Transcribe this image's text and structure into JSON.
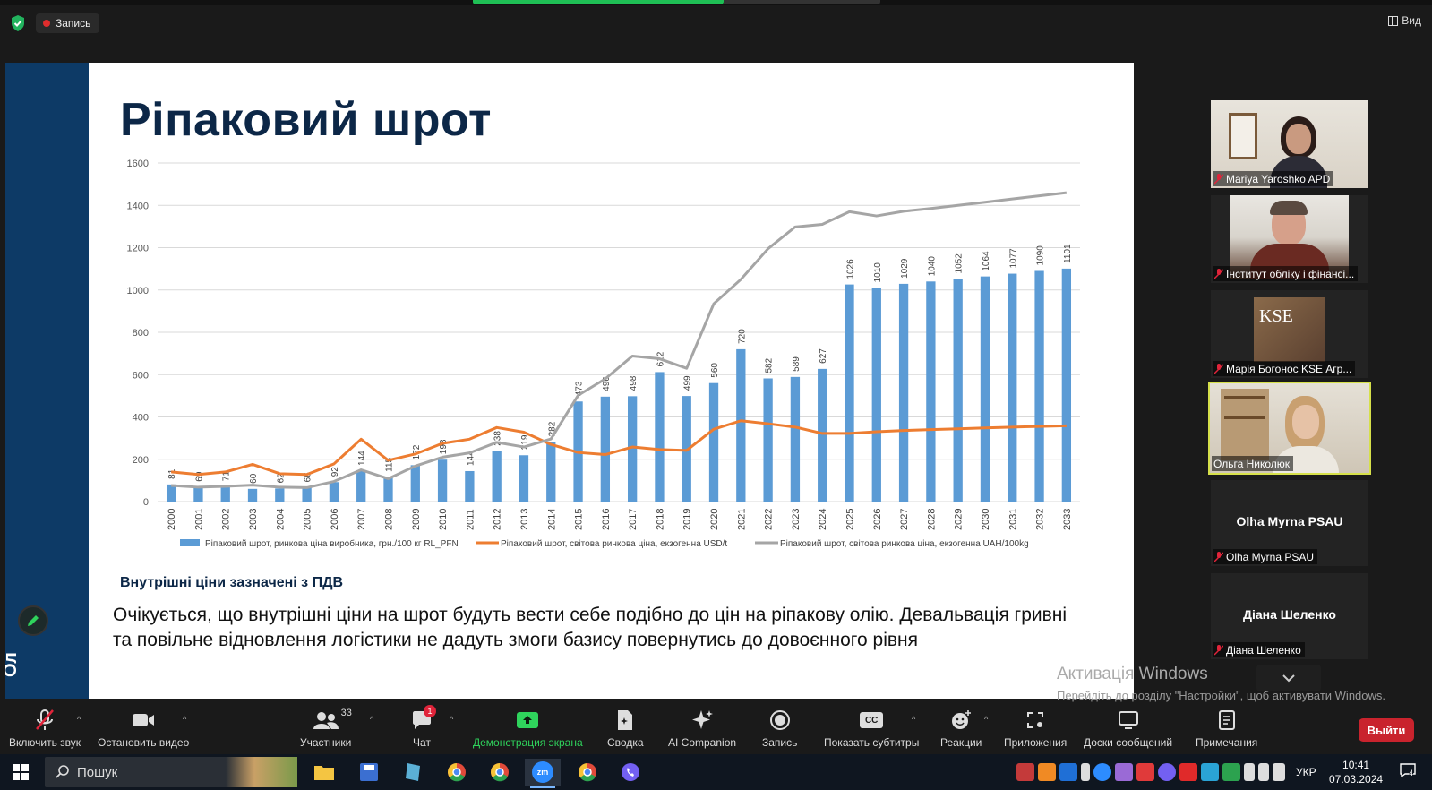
{
  "top": {
    "recording_label": "Запись",
    "view_label": "Вид"
  },
  "slide": {
    "title": "Ріпаковий шрот",
    "sidebar_text": "Ол",
    "subnote": "Внутрішні ціни зазначені з ПДВ",
    "body": "Очікується, що внутрішні ціни на шрот будуть вести себе подібно до цін на ріпакову олію. Девальвація гривні та повільне відновлення логістики не дадуть змоги базису повернутись до довоєнного рівня"
  },
  "chart_data": {
    "type": "bar",
    "categories": [
      "2000",
      "2001",
      "2002",
      "2003",
      "2004",
      "2005",
      "2006",
      "2007",
      "2008",
      "2009",
      "2010",
      "2011",
      "2012",
      "2013",
      "2014",
      "2015",
      "2016",
      "2017",
      "2018",
      "2019",
      "2020",
      "2021",
      "2022",
      "2023",
      "2024",
      "2025",
      "2026",
      "2027",
      "2028",
      "2029",
      "2030",
      "2031",
      "2032",
      "2033"
    ],
    "ylim": [
      0,
      1600
    ],
    "yticks": [
      0,
      200,
      400,
      600,
      800,
      1000,
      1200,
      1400,
      1600
    ],
    "grid": true,
    "legend_position": "bottom",
    "series": [
      {
        "name": "Ріпаковий шрот,  ринкова ціна виробника, грн./100 кг RL_PFN",
        "kind": "bar",
        "color": "#5b9bd5",
        "values": [
          81,
          69,
          71,
          60,
          62,
          66,
          92,
          144,
          115,
          172,
          198,
          144,
          238,
          219,
          282,
          473,
          496,
          498,
          612,
          499,
          560,
          720,
          582,
          589,
          627,
          1026,
          1010,
          1029,
          1040,
          1052,
          1064,
          1077,
          1090,
          1101
        ]
      },
      {
        "name": "Ріпаковий шрот, світова ринкова ціна, екзогенна USD/t",
        "kind": "line",
        "color": "#ed7d31",
        "values": [
          140,
          128,
          140,
          176,
          132,
          128,
          178,
          295,
          195,
          225,
          275,
          295,
          350,
          328,
          270,
          232,
          222,
          258,
          246,
          242,
          342,
          382,
          368,
          352,
          322,
          322,
          330,
          336,
          340,
          344,
          348,
          352,
          355,
          358
        ]
      },
      {
        "name": "Ріпаковий шрот, світова ринкова ціна, екзогенна UAH/100kg",
        "kind": "line",
        "color": "#a5a5a5",
        "values": [
          76,
          68,
          72,
          78,
          68,
          66,
          95,
          150,
          108,
          168,
          210,
          230,
          280,
          258,
          296,
          502,
          580,
          688,
          675,
          630,
          935,
          1050,
          1195,
          1298,
          1310,
          1370,
          1350,
          1372,
          1385,
          1400,
          1415,
          1430,
          1445,
          1460
        ]
      }
    ]
  },
  "participants": [
    {
      "name": "Mariya Yaroshko APD",
      "muted": true
    },
    {
      "name": "Інститут обліку і фінансі...",
      "muted": true
    },
    {
      "name": "Марія Богонос KSE Агр...",
      "muted": true,
      "logo_text": "KSE"
    },
    {
      "name": "Ольга Николюк",
      "muted": false,
      "active": true
    },
    {
      "name": "Olha Myrna PSAU",
      "muted": true,
      "avatar_text": "Olha Myrna PSAU"
    },
    {
      "name": "Діана Шеленко",
      "muted": true,
      "avatar_text": "Діана Шеленко"
    }
  ],
  "windows_activation": {
    "title": "Активація Windows",
    "text": "Перейдіть до розділу \"Настройки\", щоб активувати Windows."
  },
  "toolbar": {
    "unmute": "Включить звук",
    "stop_video": "Остановить видео",
    "participants": "Участники",
    "participants_count": "33",
    "chat": "Чат",
    "chat_badge": "1",
    "share": "Демонстрация экрана",
    "summary": "Сводка",
    "ai": "AI Companion",
    "record": "Запись",
    "captions": "Показать субтитры",
    "reactions": "Реакции",
    "apps": "Приложения",
    "whiteboards": "Доски сообщений",
    "notes": "Примечания",
    "leave": "Выйти",
    "cc_icon_text": "CC"
  },
  "taskbar": {
    "search_placeholder": "Пошук",
    "lang": "УКР",
    "time": "10:41",
    "date": "07.03.2024",
    "notifications": "4",
    "zoom_icon_text": "zm"
  },
  "colors": {
    "accent_green": "#2fd35c",
    "leave_red": "#c9232d",
    "slide_navy": "#0d3a66"
  }
}
